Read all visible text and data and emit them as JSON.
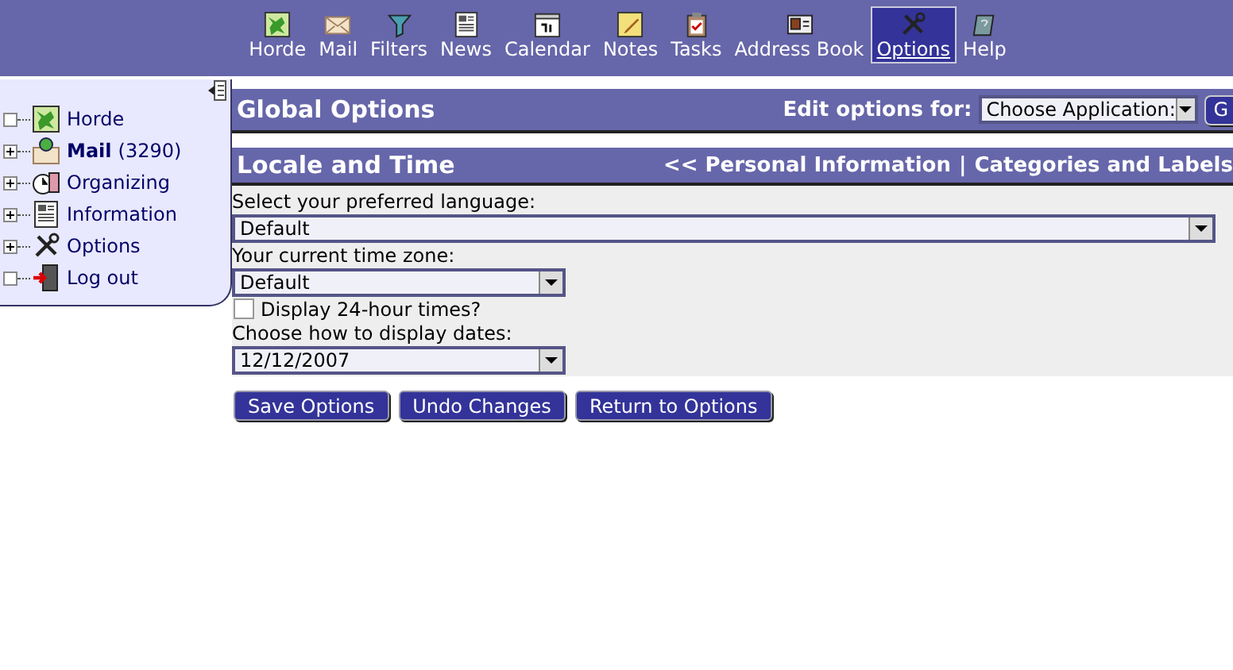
{
  "navbar": {
    "items": [
      {
        "label": "Horde",
        "selected": false
      },
      {
        "label": "Mail",
        "selected": false
      },
      {
        "label": "Filters",
        "selected": false
      },
      {
        "label": "News",
        "selected": false
      },
      {
        "label": "Calendar",
        "selected": false
      },
      {
        "label": "Notes",
        "selected": false
      },
      {
        "label": "Tasks",
        "selected": false
      },
      {
        "label": "Address Book",
        "selected": false
      },
      {
        "label": "Options",
        "selected": true
      },
      {
        "label": "Help",
        "selected": false
      }
    ]
  },
  "sidebar": {
    "items": [
      {
        "label": "Horde",
        "bold": false,
        "has_children": false
      },
      {
        "label": "Mail",
        "count": "(3290)",
        "bold": true,
        "has_children": true
      },
      {
        "label": "Organizing",
        "bold": false,
        "has_children": true
      },
      {
        "label": "Information",
        "bold": false,
        "has_children": true
      },
      {
        "label": "Options",
        "bold": false,
        "has_children": true
      },
      {
        "label": "Log out",
        "bold": false,
        "has_children": false
      }
    ]
  },
  "global_options": {
    "title": "Global Options",
    "edit_label": "Edit options for:",
    "application_select": {
      "value": "Choose Application:"
    },
    "go_button": "G"
  },
  "section": {
    "title": "Locale and Time",
    "links": [
      "<< Personal Information",
      "Categories and Labels"
    ],
    "separator": "|"
  },
  "fields": [
    {
      "kind": "wide-select",
      "label": "Select your preferred language:",
      "value": "Default"
    },
    {
      "kind": "select",
      "label": "Your current time zone:",
      "value": "Default"
    },
    {
      "kind": "checkbox",
      "label": "Display 24-hour times?",
      "checked": false
    },
    {
      "kind": "select",
      "label": "Choose how to display dates:",
      "value": "12/12/2007"
    }
  ],
  "buttons": [
    "Save Options",
    "Undo Changes",
    "Return to Options"
  ]
}
